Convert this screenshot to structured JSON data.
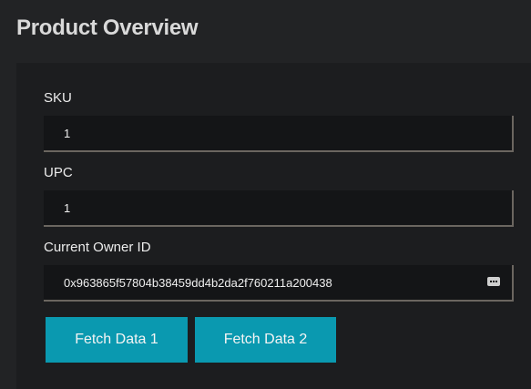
{
  "page": {
    "title": "Product Overview"
  },
  "form": {
    "sku": {
      "label": "SKU",
      "value": "1"
    },
    "upc": {
      "label": "UPC",
      "value": "1"
    },
    "owner": {
      "label": "Current Owner ID",
      "value": "0x963865f57804b38459dd4b2da2f760211a200438"
    }
  },
  "buttons": {
    "fetch1_label": "Fetch Data 1",
    "fetch2_label": "Fetch Data 2"
  },
  "icons": {
    "owner_field_icon": "keyboard-icon"
  },
  "colors": {
    "background": "#222325",
    "card": "#1c1d1f",
    "input": "#141517",
    "button": "#0a99b0"
  }
}
